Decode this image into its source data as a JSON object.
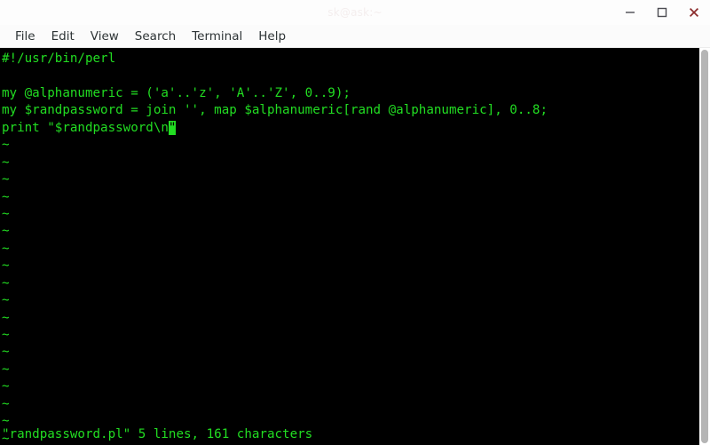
{
  "window": {
    "title": "sk@ask:~",
    "controls": [
      {
        "name": "minimize",
        "label": "Minimize"
      },
      {
        "name": "maximize",
        "label": "Maximize"
      },
      {
        "name": "close",
        "label": "Close"
      }
    ]
  },
  "menubar": {
    "items": [
      {
        "label": "File"
      },
      {
        "label": "Edit"
      },
      {
        "label": "View"
      },
      {
        "label": "Search"
      },
      {
        "label": "Terminal"
      },
      {
        "label": "Help"
      }
    ]
  },
  "terminal": {
    "foreground_color": "#22dd22",
    "background_color": "#000000",
    "lines": [
      "#!/usr/bin/perl",
      "",
      "my @alphanumeric = ('a'..'z', 'A'..'Z', 0..9);",
      "my $randpassword = join '', map $alphanumeric[rand @alphanumeric], 0..8;"
    ],
    "cursor_line_prefix": "print \"$randpassword\\n",
    "cursor_char": "\"",
    "tilde": "~",
    "tilde_count": 18,
    "status_line": "\"randpassword.pl\" 5 lines, 161 characters"
  },
  "scrollbar": {
    "thumb_color": "#b5b5b5"
  }
}
